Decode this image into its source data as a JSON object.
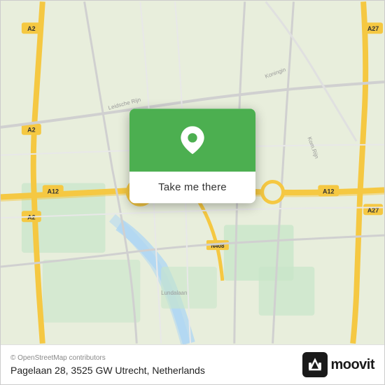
{
  "map": {
    "center_lat": 52.08,
    "center_lon": 5.08,
    "zoom": 13
  },
  "popup": {
    "button_label": "Take me there",
    "pin_color": "#ffffff",
    "bg_color": "#4CAF50"
  },
  "bottom_bar": {
    "attribution": "© OpenStreetMap contributors",
    "address": "Pagelaan 28, 3525 GW Utrecht, Netherlands",
    "logo_text": "moovit"
  }
}
